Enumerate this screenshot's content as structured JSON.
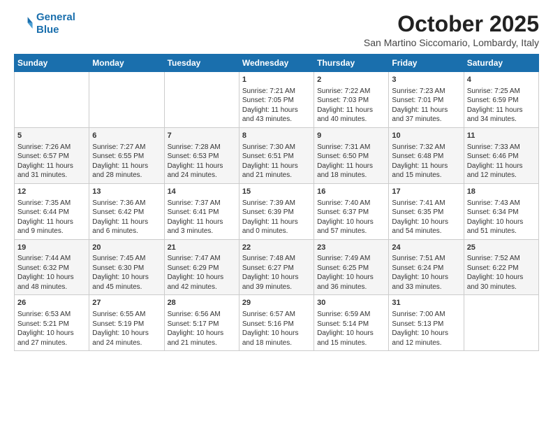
{
  "header": {
    "logo_line1": "General",
    "logo_line2": "Blue",
    "month_title": "October 2025",
    "location": "San Martino Siccomario, Lombardy, Italy"
  },
  "weekdays": [
    "Sunday",
    "Monday",
    "Tuesday",
    "Wednesday",
    "Thursday",
    "Friday",
    "Saturday"
  ],
  "weeks": [
    [
      {
        "day": "",
        "content": ""
      },
      {
        "day": "",
        "content": ""
      },
      {
        "day": "",
        "content": ""
      },
      {
        "day": "1",
        "content": "Sunrise: 7:21 AM\nSunset: 7:05 PM\nDaylight: 11 hours\nand 43 minutes."
      },
      {
        "day": "2",
        "content": "Sunrise: 7:22 AM\nSunset: 7:03 PM\nDaylight: 11 hours\nand 40 minutes."
      },
      {
        "day": "3",
        "content": "Sunrise: 7:23 AM\nSunset: 7:01 PM\nDaylight: 11 hours\nand 37 minutes."
      },
      {
        "day": "4",
        "content": "Sunrise: 7:25 AM\nSunset: 6:59 PM\nDaylight: 11 hours\nand 34 minutes."
      }
    ],
    [
      {
        "day": "5",
        "content": "Sunrise: 7:26 AM\nSunset: 6:57 PM\nDaylight: 11 hours\nand 31 minutes."
      },
      {
        "day": "6",
        "content": "Sunrise: 7:27 AM\nSunset: 6:55 PM\nDaylight: 11 hours\nand 28 minutes."
      },
      {
        "day": "7",
        "content": "Sunrise: 7:28 AM\nSunset: 6:53 PM\nDaylight: 11 hours\nand 24 minutes."
      },
      {
        "day": "8",
        "content": "Sunrise: 7:30 AM\nSunset: 6:51 PM\nDaylight: 11 hours\nand 21 minutes."
      },
      {
        "day": "9",
        "content": "Sunrise: 7:31 AM\nSunset: 6:50 PM\nDaylight: 11 hours\nand 18 minutes."
      },
      {
        "day": "10",
        "content": "Sunrise: 7:32 AM\nSunset: 6:48 PM\nDaylight: 11 hours\nand 15 minutes."
      },
      {
        "day": "11",
        "content": "Sunrise: 7:33 AM\nSunset: 6:46 PM\nDaylight: 11 hours\nand 12 minutes."
      }
    ],
    [
      {
        "day": "12",
        "content": "Sunrise: 7:35 AM\nSunset: 6:44 PM\nDaylight: 11 hours\nand 9 minutes."
      },
      {
        "day": "13",
        "content": "Sunrise: 7:36 AM\nSunset: 6:42 PM\nDaylight: 11 hours\nand 6 minutes."
      },
      {
        "day": "14",
        "content": "Sunrise: 7:37 AM\nSunset: 6:41 PM\nDaylight: 11 hours\nand 3 minutes."
      },
      {
        "day": "15",
        "content": "Sunrise: 7:39 AM\nSunset: 6:39 PM\nDaylight: 11 hours\nand 0 minutes."
      },
      {
        "day": "16",
        "content": "Sunrise: 7:40 AM\nSunset: 6:37 PM\nDaylight: 10 hours\nand 57 minutes."
      },
      {
        "day": "17",
        "content": "Sunrise: 7:41 AM\nSunset: 6:35 PM\nDaylight: 10 hours\nand 54 minutes."
      },
      {
        "day": "18",
        "content": "Sunrise: 7:43 AM\nSunset: 6:34 PM\nDaylight: 10 hours\nand 51 minutes."
      }
    ],
    [
      {
        "day": "19",
        "content": "Sunrise: 7:44 AM\nSunset: 6:32 PM\nDaylight: 10 hours\nand 48 minutes."
      },
      {
        "day": "20",
        "content": "Sunrise: 7:45 AM\nSunset: 6:30 PM\nDaylight: 10 hours\nand 45 minutes."
      },
      {
        "day": "21",
        "content": "Sunrise: 7:47 AM\nSunset: 6:29 PM\nDaylight: 10 hours\nand 42 minutes."
      },
      {
        "day": "22",
        "content": "Sunrise: 7:48 AM\nSunset: 6:27 PM\nDaylight: 10 hours\nand 39 minutes."
      },
      {
        "day": "23",
        "content": "Sunrise: 7:49 AM\nSunset: 6:25 PM\nDaylight: 10 hours\nand 36 minutes."
      },
      {
        "day": "24",
        "content": "Sunrise: 7:51 AM\nSunset: 6:24 PM\nDaylight: 10 hours\nand 33 minutes."
      },
      {
        "day": "25",
        "content": "Sunrise: 7:52 AM\nSunset: 6:22 PM\nDaylight: 10 hours\nand 30 minutes."
      }
    ],
    [
      {
        "day": "26",
        "content": "Sunrise: 6:53 AM\nSunset: 5:21 PM\nDaylight: 10 hours\nand 27 minutes."
      },
      {
        "day": "27",
        "content": "Sunrise: 6:55 AM\nSunset: 5:19 PM\nDaylight: 10 hours\nand 24 minutes."
      },
      {
        "day": "28",
        "content": "Sunrise: 6:56 AM\nSunset: 5:17 PM\nDaylight: 10 hours\nand 21 minutes."
      },
      {
        "day": "29",
        "content": "Sunrise: 6:57 AM\nSunset: 5:16 PM\nDaylight: 10 hours\nand 18 minutes."
      },
      {
        "day": "30",
        "content": "Sunrise: 6:59 AM\nSunset: 5:14 PM\nDaylight: 10 hours\nand 15 minutes."
      },
      {
        "day": "31",
        "content": "Sunrise: 7:00 AM\nSunset: 5:13 PM\nDaylight: 10 hours\nand 12 minutes."
      },
      {
        "day": "",
        "content": ""
      }
    ]
  ]
}
